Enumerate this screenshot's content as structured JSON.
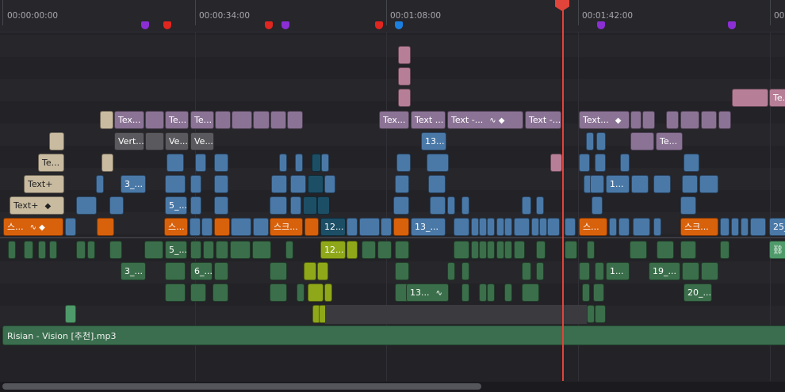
{
  "ruler": {
    "timecodes": [
      "00:00:00:00",
      "00:00:34:00",
      "00:01:08:00",
      "00:01:42:00",
      "00:0"
    ]
  },
  "markers": [
    {
      "color": "#8b2fd4"
    },
    {
      "color": "#e0261f"
    },
    {
      "color": "#e0261f"
    },
    {
      "color": "#8b2fd4"
    },
    {
      "color": "#e0261f"
    },
    {
      "color": "#1b7fe0"
    },
    {
      "color": "#8b2fd4"
    },
    {
      "color": "#8b2fd4"
    }
  ],
  "clips": {
    "te_right": "Te...",
    "text_a": "Tex...",
    "te_b": "Te...",
    "te_c": "Te...",
    "text_d": "Tex...",
    "text_e": "Text ...",
    "text_f": "Text -...",
    "text_g": "Text -...",
    "text_h": "Text...",
    "vert_a": "Vert...",
    "ve_b": "Ve...",
    "ve_c": "Ve...",
    "n13_a": "13...",
    "te_d": "Te...",
    "te_e": "Te...",
    "textplus_a": "Text+",
    "n3_a": "3_...",
    "n1_a": "1...",
    "textplus_b": "Text+",
    "n5_a": "5_...",
    "seu_a": "스...",
    "seukeu_a": "스크...",
    "n12_a": "12...",
    "n13_b": "13_...",
    "seu_b": "스...",
    "seukeu_b": "스크...",
    "n25": "25_",
    "n5_b": "5_...",
    "n12_b": "12...",
    "n3_b": "3_...",
    "n6": "6_...",
    "n1_b": "1...",
    "n19": "19_...",
    "n13_c": "13...",
    "n20": "20_..."
  },
  "audio_clip": {
    "label": "Risian - Vision [추천].mp3"
  }
}
